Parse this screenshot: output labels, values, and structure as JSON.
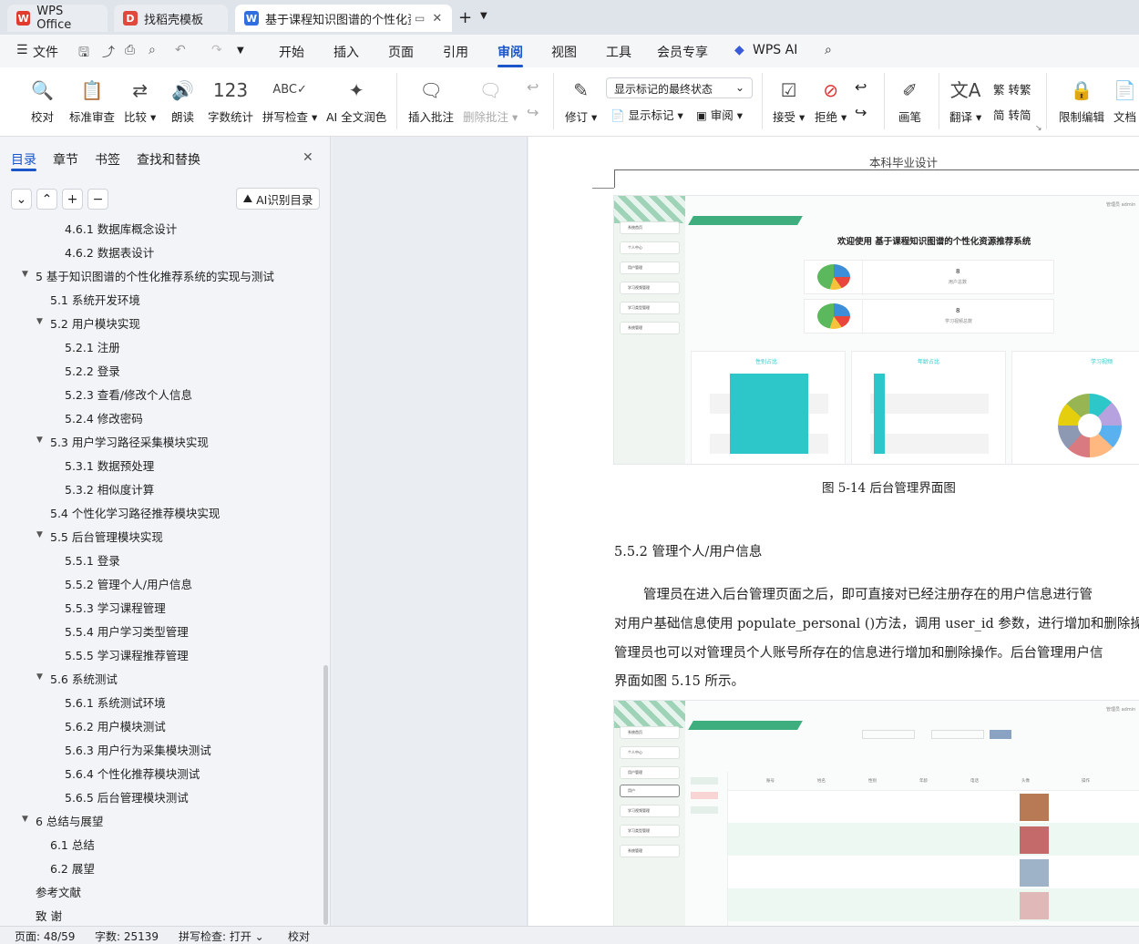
{
  "tabs": [
    {
      "label": "WPS Office"
    },
    {
      "label": "找稻壳模板"
    },
    {
      "label": "基于课程知识图谱的个性化资"
    }
  ],
  "menu": {
    "file": "文件",
    "items": [
      "开始",
      "插入",
      "页面",
      "引用",
      "审阅",
      "视图",
      "工具",
      "会员专享"
    ],
    "wps_ai": "WPS AI"
  },
  "ribbon": {
    "proofread": "校对",
    "std_review": "标准审查",
    "compare": "比较",
    "read_aloud": "朗读",
    "word_count": "字数统计",
    "spell_check": "拼写检查",
    "ai_polish": "AI 全文润色",
    "insert_comment": "插入批注",
    "delete_comment": "删除批注",
    "revise": "修订",
    "show_markup_state": "显示标记的最终状态",
    "show_markup": "显示标记",
    "review": "审阅",
    "accept": "接受",
    "reject": "拒绝",
    "pen": "画笔",
    "translate": "翻译",
    "to_traditional": "转繁",
    "to_simplified": "转简",
    "restrict_edit": "限制编辑",
    "doc_more": "文档"
  },
  "panel": {
    "tabs": [
      "目录",
      "章节",
      "书签",
      "查找和替换"
    ],
    "ai_toc": "AI识别目录"
  },
  "toc": [
    {
      "t": "4.6.1  数据库概念设计",
      "lv": 3
    },
    {
      "t": "4.6.2  数据表设计",
      "lv": 3
    },
    {
      "t": "5  基于知识图谱的个性化推荐系统的实现与测试",
      "lv": 1
    },
    {
      "t": "5.1  系统开发环境",
      "lv": 2
    },
    {
      "t": "5.2  用户模块实现",
      "lv": 2
    },
    {
      "t": "5.2.1  注册",
      "lv": 3
    },
    {
      "t": "5.2.2  登录",
      "lv": 3
    },
    {
      "t": "5.2.3  查看/修改个人信息",
      "lv": 3
    },
    {
      "t": "5.2.4  修改密码",
      "lv": 3
    },
    {
      "t": "5.3  用户学习路径采集模块实现",
      "lv": 2
    },
    {
      "t": "5.3.1  数据预处理",
      "lv": 3
    },
    {
      "t": "5.3.2  相似度计算",
      "lv": 3
    },
    {
      "t": "5.4  个性化学习路径推荐模块实现",
      "lv": 2
    },
    {
      "t": "5.5  后台管理模块实现",
      "lv": 2
    },
    {
      "t": "5.5.1  登录",
      "lv": 3
    },
    {
      "t": "5.5.2  管理个人/用户信息",
      "lv": 3
    },
    {
      "t": "5.5.3  学习课程管理",
      "lv": 3
    },
    {
      "t": "5.5.4  用户学习类型管理",
      "lv": 3
    },
    {
      "t": "5.5.5  学习课程推荐管理",
      "lv": 3
    },
    {
      "t": "5.6 系统测试",
      "lv": 2
    },
    {
      "t": "5.6.1  系统测试环境",
      "lv": 3
    },
    {
      "t": "5.6.2  用户模块测试",
      "lv": 3
    },
    {
      "t": "5.6.3  用户行为采集模块测试",
      "lv": 3
    },
    {
      "t": "5.6.4  个性化推荐模块测试",
      "lv": 3
    },
    {
      "t": "5.6.5  后台管理模块测试",
      "lv": 3
    },
    {
      "t": "6  总结与展望",
      "lv": 1
    },
    {
      "t": "6.1  总结",
      "lv": 2
    },
    {
      "t": "6.2  展望",
      "lv": 2
    },
    {
      "t": "参考文献",
      "lv": 1
    },
    {
      "t": "致    谢",
      "lv": 1
    }
  ],
  "doc": {
    "header": "本科毕业设计",
    "fig_caption": "图 5-14  后台管理界面图",
    "section": "5.5.2  管理个人/用户信息",
    "para": [
      "管理员在进入后台管理页面之后，即可直接对已经注册存在的用户信息进行管",
      "对用户基础信息使用 populate_personal ()方法，调用 user_id 参数，进行增加和删除操",
      "管理员也可以对管理员个人账号所存在的信息进行增加和删除操作。后台管理用户信",
      "界面如图 5.15 所示。"
    ],
    "shot1": {
      "welcome": "欢迎使用  基于课程知识图谱的个性化资源推荐系统",
      "admin": "管理员 admin",
      "count1": "8",
      "count1_label": "用户总数",
      "count2": "8",
      "count2_label": "学习视频总数",
      "chart1": "性别占比",
      "chart2": "年龄占比",
      "chart3": "学习视频",
      "side": [
        "系统首页",
        "个人中心",
        "用户管理",
        "学习视频管理",
        "学习类型管理",
        "系统管理"
      ]
    },
    "shot2": {
      "admin": "管理员 admin",
      "side": [
        "系统首页",
        "个人中心",
        "用户管理",
        "用户",
        "学习视频管理",
        "学习类型管理",
        "系统管理"
      ],
      "cols": [
        "账号",
        "姓名",
        "性别",
        "年龄",
        "电话",
        "头像",
        "操作"
      ]
    }
  },
  "status": {
    "page": "页面: 48/59",
    "words": "字数: 25139",
    "spell": "拼写检查: 打开",
    "proof": "校对"
  },
  "colors": {
    "accent": "#1a56c9",
    "teal": "#2ec7c9",
    "wps_red": "#e23b2e"
  }
}
